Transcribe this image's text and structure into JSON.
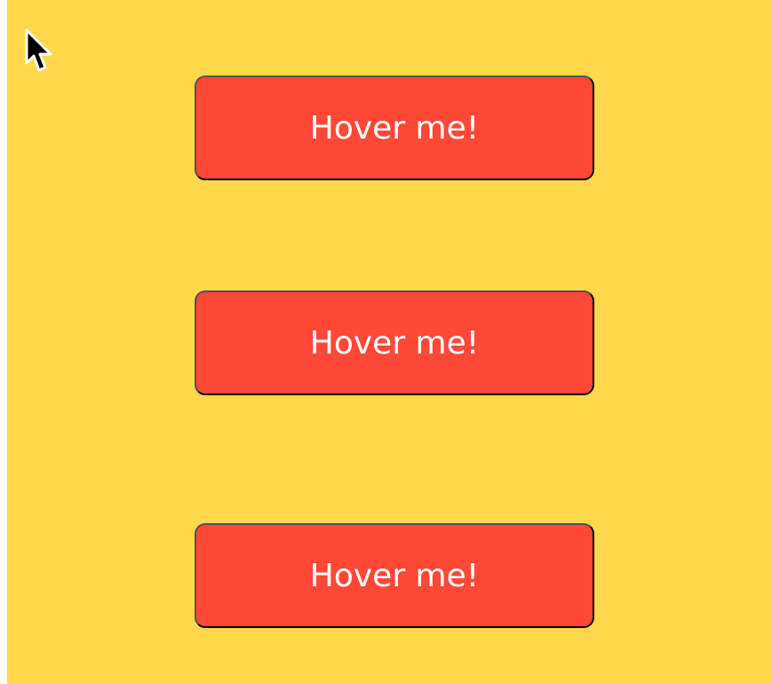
{
  "page": {
    "background_color": "#ffd84c",
    "button_color": "#ff4836",
    "button_text_color": "#ffffff"
  },
  "buttons": [
    {
      "label": "Hover me!"
    },
    {
      "label": "Hover me!"
    },
    {
      "label": "Hover me!"
    }
  ],
  "icons": {
    "cursor": "mouse-pointer-icon"
  }
}
